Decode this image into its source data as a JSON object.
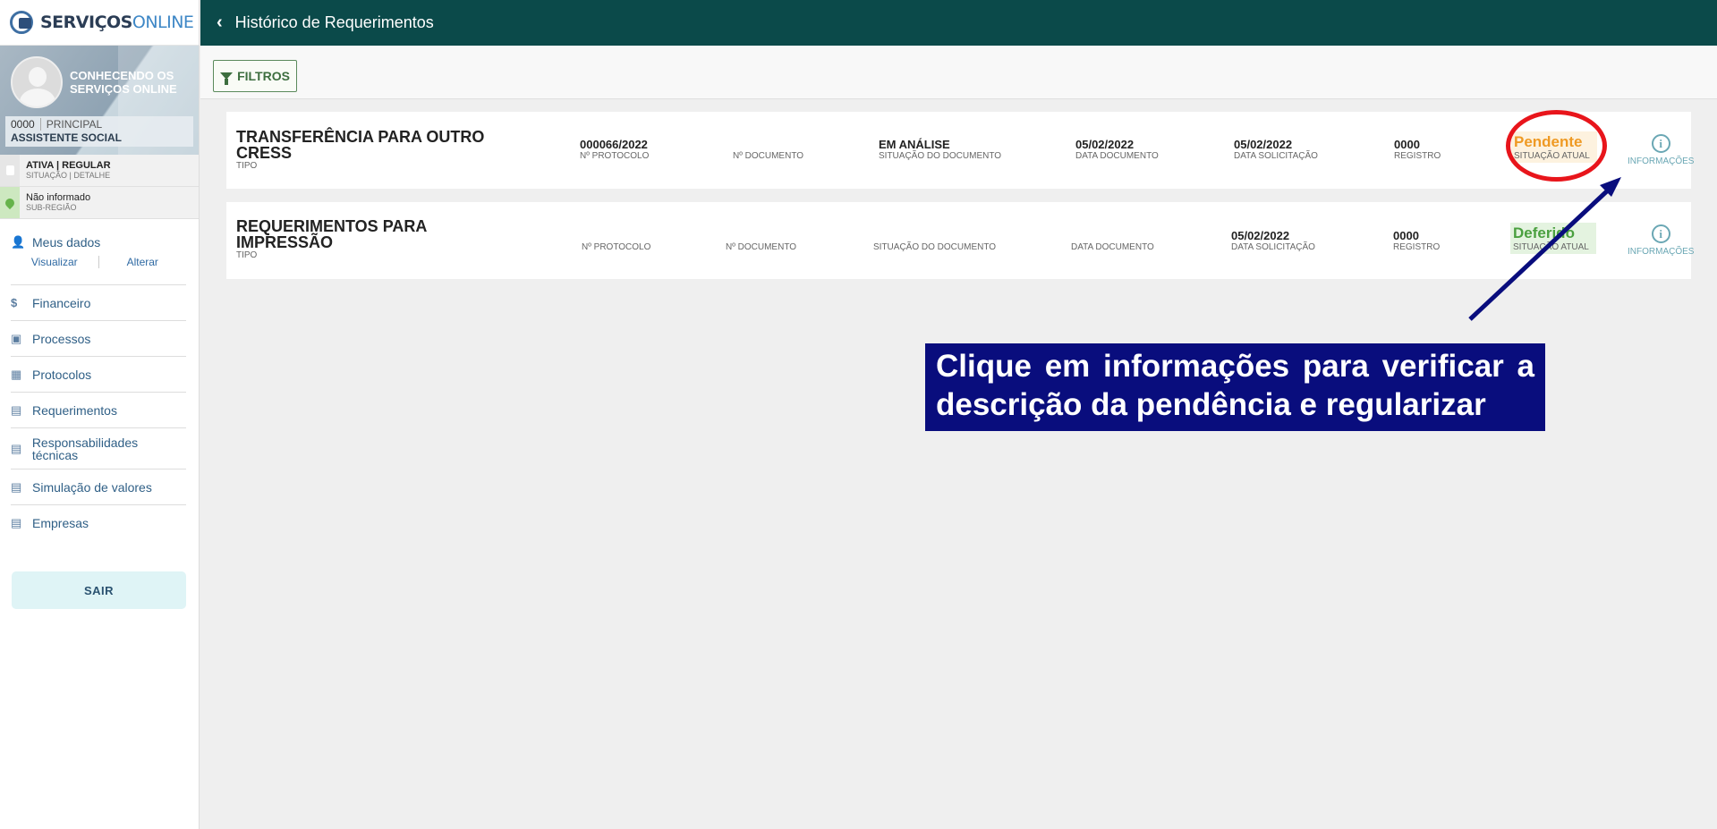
{
  "brand": {
    "left": "SERVIÇOS",
    "right": "ONLINE"
  },
  "profile": {
    "name": "CONHECENDO OS SERVIÇOS ONLINE",
    "number": "0000",
    "category": "PRINCIPAL",
    "role": "ASSISTENTE SOCIAL"
  },
  "status": {
    "situation": {
      "value": "ATIVA | REGULAR",
      "label": "SITUAÇÃO | DETALHE"
    },
    "region": {
      "value": "Não informado",
      "label": "SUB-REGIÃO"
    }
  },
  "menu": {
    "meus_dados": "Meus dados",
    "visualizar": "Visualizar",
    "alterar": "Alterar",
    "items": [
      "Financeiro",
      "Processos",
      "Protocolos",
      "Requerimentos",
      "Responsabilidades técnicas",
      "Simulação de valores",
      "Empresas"
    ],
    "logout": "SAIR"
  },
  "header": {
    "title": "Histórico de Requerimentos",
    "back_icon": "chevron-left-icon"
  },
  "filters": {
    "label": "FILTROS"
  },
  "labels": {
    "tipo": "TIPO",
    "protocolo": "Nº PROTOCOLO",
    "documento": "Nº DOCUMENTO",
    "situacao_doc": "SITUAÇÃO DO DOCUMENTO",
    "data_doc": "DATA DOCUMENTO",
    "data_sol": "DATA SOLICITAÇÃO",
    "registro": "REGISTRO",
    "situacao_atual": "SITUAÇÃO ATUAL",
    "info": "INFORMAÇÕES"
  },
  "requests": [
    {
      "type": "TRANSFERÊNCIA PARA OUTRO CRESS",
      "protocol": "000066/2022",
      "document": "",
      "doc_status": "EM ANÁLISE",
      "doc_date": "05/02/2022",
      "request_date": "05/02/2022",
      "registry": "0000",
      "current_status": "Pendente"
    },
    {
      "type": "REQUERIMENTOS PARA IMPRESSÃO",
      "protocol": "",
      "document": "",
      "doc_status": "",
      "doc_date": "",
      "request_date": "05/02/2022",
      "registry": "0000",
      "current_status": "Deferido"
    }
  ],
  "annotation": {
    "text": "Clique em informações para verificar a descrição da pendência e regularizar",
    "ring_color": "#e8151b",
    "arrow_color": "#090d7d"
  },
  "colors": {
    "header": "#0b4a4a",
    "pending": "#ef9a24",
    "approved": "#4aa03f"
  }
}
